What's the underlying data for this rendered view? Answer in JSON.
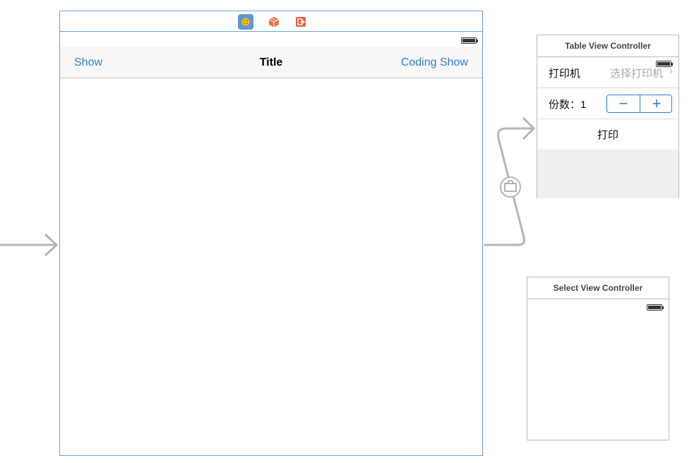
{
  "main_scene": {
    "dock_icons": [
      "view-controller-icon",
      "first-responder-icon",
      "exit-icon"
    ],
    "navbar": {
      "left_button": "Show",
      "title": "Title",
      "right_button": "Coding Show"
    }
  },
  "table_view_controller": {
    "title": "Table View Controller",
    "rows": {
      "printer_label": "打印机",
      "printer_detail": "选择打印机",
      "copies_label": "份数：",
      "copies_value": "1",
      "print_button": "打印"
    },
    "stepper": {
      "minus": "−",
      "plus": "+"
    }
  },
  "select_view_controller": {
    "title": "Select View Controller"
  },
  "colors": {
    "accent": "#2f7fd6",
    "selected_border": "#6fa2d9",
    "segue_line": "#b5b5b5"
  }
}
